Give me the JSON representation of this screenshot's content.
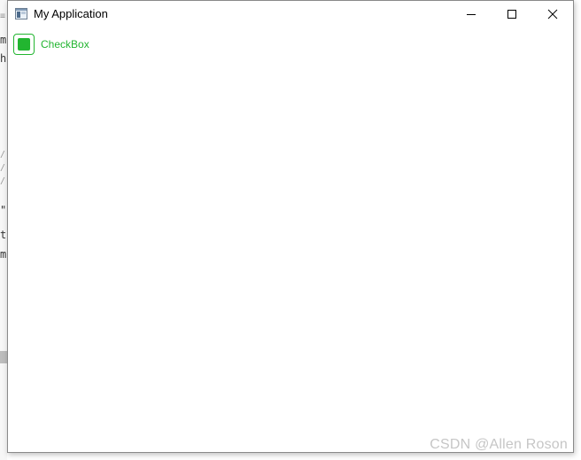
{
  "background": {
    "fragments": [
      "m",
      "h",
      "\"",
      "t",
      "m"
    ]
  },
  "window": {
    "title": "My Application",
    "icons": {
      "app": "application-window-icon",
      "minimize": "minimize-icon",
      "maximize": "maximize-icon",
      "close": "close-icon"
    }
  },
  "checkbox": {
    "label": "CheckBox",
    "checked": true,
    "color": "#22b530"
  },
  "watermark": "CSDN @Allen Roson"
}
